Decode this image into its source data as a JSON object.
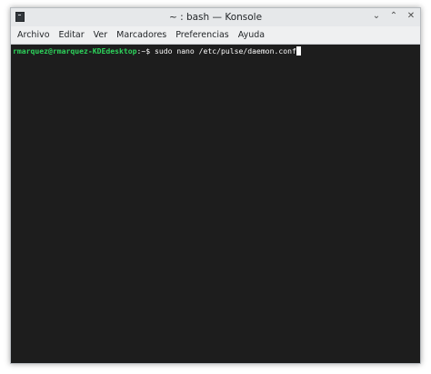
{
  "window": {
    "title": "~ : bash — Konsole",
    "controls": {
      "minimize": "⌄",
      "maximize": "⌃",
      "close": "✕"
    }
  },
  "menu": [
    "Archivo",
    "Editar",
    "Ver",
    "Marcadores",
    "Preferencias",
    "Ayuda"
  ],
  "terminal": {
    "user_host": "rmarquez@rmarquez-KDEdesktop",
    "path": ":~$",
    "command": " sudo nano /etc/pulse/daemon.conf"
  },
  "colors": {
    "terminal_bg": "#1d1d1d",
    "prompt_green": "#2dd35b",
    "text": "#fcfcfc"
  }
}
